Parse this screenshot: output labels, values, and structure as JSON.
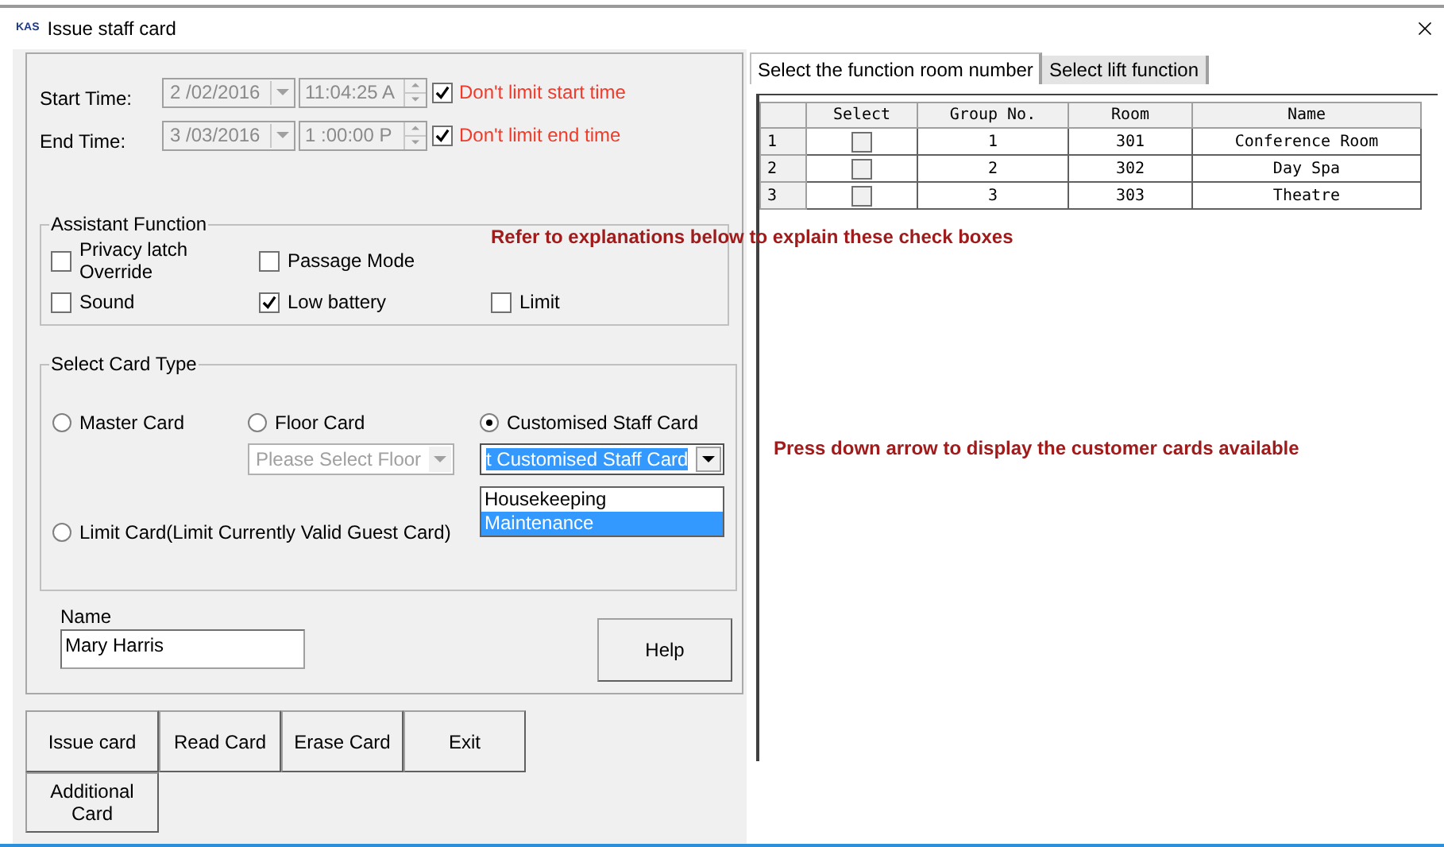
{
  "window": {
    "logo": "KAS",
    "title": "Issue staff card"
  },
  "time_limits": [
    {
      "label": "Start Time:",
      "date": "2 /02/2016",
      "time": "11:04:25 A",
      "checkbox_label": "Don't limit start time",
      "checked": true
    },
    {
      "label": "End Time:",
      "date": "3 /03/2016",
      "time": "1 :00:00 P",
      "checkbox_label": "Don't limit end time",
      "checked": true
    }
  ],
  "assistant_function": {
    "title": "Assistant Function",
    "options": [
      {
        "label": "Privacy latch Override",
        "checked": false
      },
      {
        "label": "Passage Mode",
        "checked": false
      },
      {
        "label": "Sound",
        "checked": false
      },
      {
        "label": "Low battery",
        "checked": true
      },
      {
        "label": "Limit",
        "checked": false
      }
    ]
  },
  "card_type": {
    "title": "Select Card Type",
    "options": [
      {
        "label": "Master Card",
        "selected": false
      },
      {
        "label": "Floor Card",
        "selected": false
      },
      {
        "label": "Customised Staff Card",
        "selected": true
      },
      {
        "label": "Limit Card(Limit Currently Valid Guest Card)",
        "selected": false
      }
    ],
    "floor_select": {
      "value": "Please Select Floor",
      "disabled": true
    },
    "custom_select": {
      "value": "t Customised Staff Card",
      "options": [
        {
          "label": "Housekeeping",
          "selected": false
        },
        {
          "label": "Maintenance",
          "selected": true
        }
      ]
    }
  },
  "name": {
    "label": "Name",
    "value": "Mary Harris"
  },
  "help_button": "Help",
  "action_buttons": [
    "Issue card",
    "Read Card",
    "Erase Card",
    "Exit",
    "Additional Card"
  ],
  "tabs": [
    {
      "label": "Select the function room number",
      "selected": true
    },
    {
      "label": "Select lift function",
      "selected": false
    }
  ],
  "table": {
    "columns": [
      "Select",
      "Group No.",
      "Room",
      "Name"
    ],
    "rows": [
      {
        "index": "1",
        "checked": false,
        "group": "1",
        "room": "301",
        "name": "Conference Room"
      },
      {
        "index": "2",
        "checked": false,
        "group": "2",
        "room": "302",
        "name": "Day Spa"
      },
      {
        "index": "3",
        "checked": false,
        "group": "3",
        "room": "303",
        "name": "Theatre"
      }
    ]
  },
  "annotations": [
    "Refer to explanations below to explain these check boxes",
    "Press down arrow to display the customer cards available"
  ]
}
